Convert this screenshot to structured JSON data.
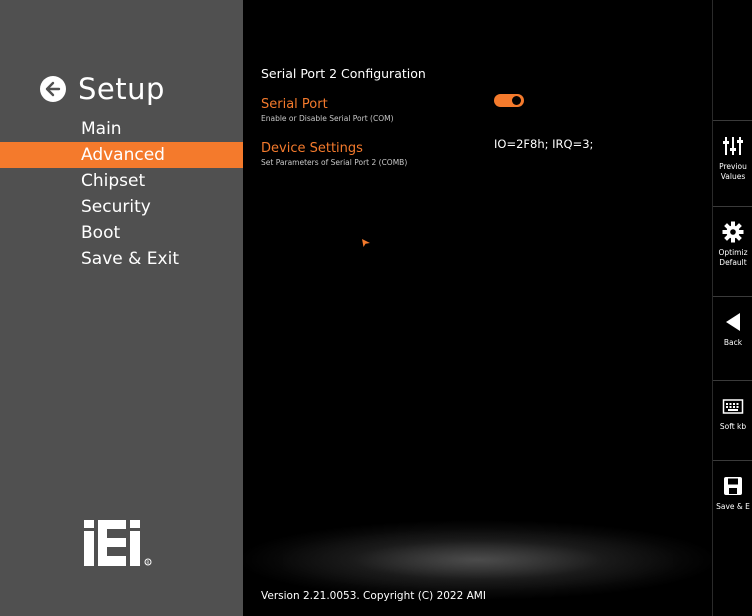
{
  "sidebar": {
    "title": "Setup",
    "items": [
      {
        "label": "Main",
        "active": false
      },
      {
        "label": "Advanced",
        "active": true
      },
      {
        "label": "Chipset",
        "active": false
      },
      {
        "label": "Security",
        "active": false
      },
      {
        "label": "Boot",
        "active": false
      },
      {
        "label": "Save & Exit",
        "active": false
      }
    ],
    "logo": "iEi"
  },
  "main": {
    "section_title": "Serial Port 2 Configuration",
    "options": [
      {
        "label": "Serial Port",
        "help": "Enable or Disable Serial Port (COM)",
        "type": "toggle",
        "enabled": true
      },
      {
        "label": "Device Settings",
        "help": "Set Parameters of Serial Port 2 (COMB)",
        "type": "value",
        "value": "IO=2F8h; IRQ=3;"
      }
    ],
    "version": "Version 2.21.0053. Copyright (C) 2022 AMI"
  },
  "rail": {
    "buttons": [
      {
        "icon": "sliders-icon",
        "label_line1": "Previou",
        "label_line2": "Values"
      },
      {
        "icon": "gear-icon",
        "label_line1": "Optimiz",
        "label_line2": "Default"
      },
      {
        "icon": "back-triangle-icon",
        "label_line1": "Back",
        "label_line2": ""
      },
      {
        "icon": "keyboard-icon",
        "label_line1": "Soft kb",
        "label_line2": ""
      },
      {
        "icon": "floppy-disk-icon",
        "label_line1": "Save & E",
        "label_line2": ""
      }
    ]
  },
  "colors": {
    "accent": "#f47a2c",
    "sidebar_bg": "#505050",
    "main_bg": "#000000"
  }
}
